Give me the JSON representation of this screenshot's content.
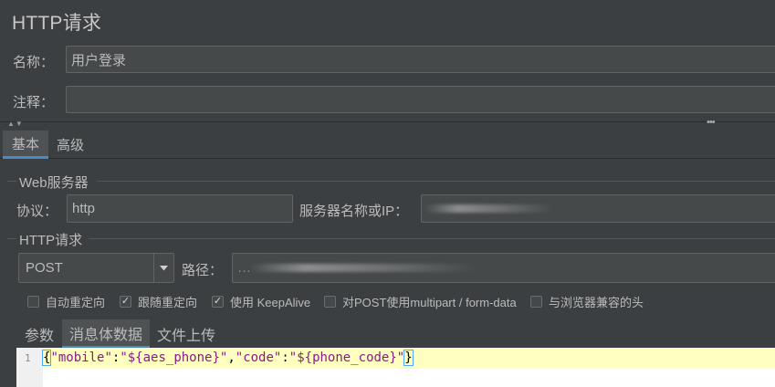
{
  "title": "HTTP请求",
  "form": {
    "name_label": "名称：",
    "name_value": "用户登录",
    "comment_label": "注释：",
    "comment_value": ""
  },
  "split": {
    "arrows": "▲▼",
    "dots": "•••"
  },
  "tabs": [
    {
      "label": "基本",
      "active": true
    },
    {
      "label": "高级",
      "active": false
    }
  ],
  "web_server": {
    "group_title": "Web服务器",
    "protocol_label": "协议：",
    "protocol_value": "http",
    "server_label": "服务器名称或IP：",
    "server_value": "…"
  },
  "http_request": {
    "group_title": "HTTP请求",
    "method": "POST",
    "dropdown_icon": "triangle-down",
    "path_label": "路径：",
    "path_value": "…"
  },
  "checkboxes": [
    {
      "label": "自动重定向",
      "checked": false
    },
    {
      "label": "跟随重定向",
      "checked": true
    },
    {
      "label": "使用 KeepAlive",
      "checked": true
    },
    {
      "label": "对POST使用multipart / form-data",
      "checked": false
    },
    {
      "label": "与浏览器兼容的头",
      "checked": false
    }
  ],
  "check_mark": "✓",
  "sub_tabs": [
    {
      "label": "参数",
      "active": false
    },
    {
      "label": "消息体数据",
      "active": true
    },
    {
      "label": "文件上传",
      "active": false
    }
  ],
  "editor": {
    "line_number": "1",
    "tokens": {
      "open": "{",
      "k1": "\"mobile\"",
      "c1": ":",
      "v1": "\"${aes_phone}\"",
      "comma": ",",
      "k2": "\"code\"",
      "c2": ":",
      "v2": "\"${phone_code}\"",
      "close": "}"
    }
  },
  "colors": {
    "background": "#3c3f41",
    "accent": "#4a88c7",
    "editor_current_line": "#ffffbf",
    "json_string": "#8b1a8b",
    "caret": "#ff0000"
  }
}
